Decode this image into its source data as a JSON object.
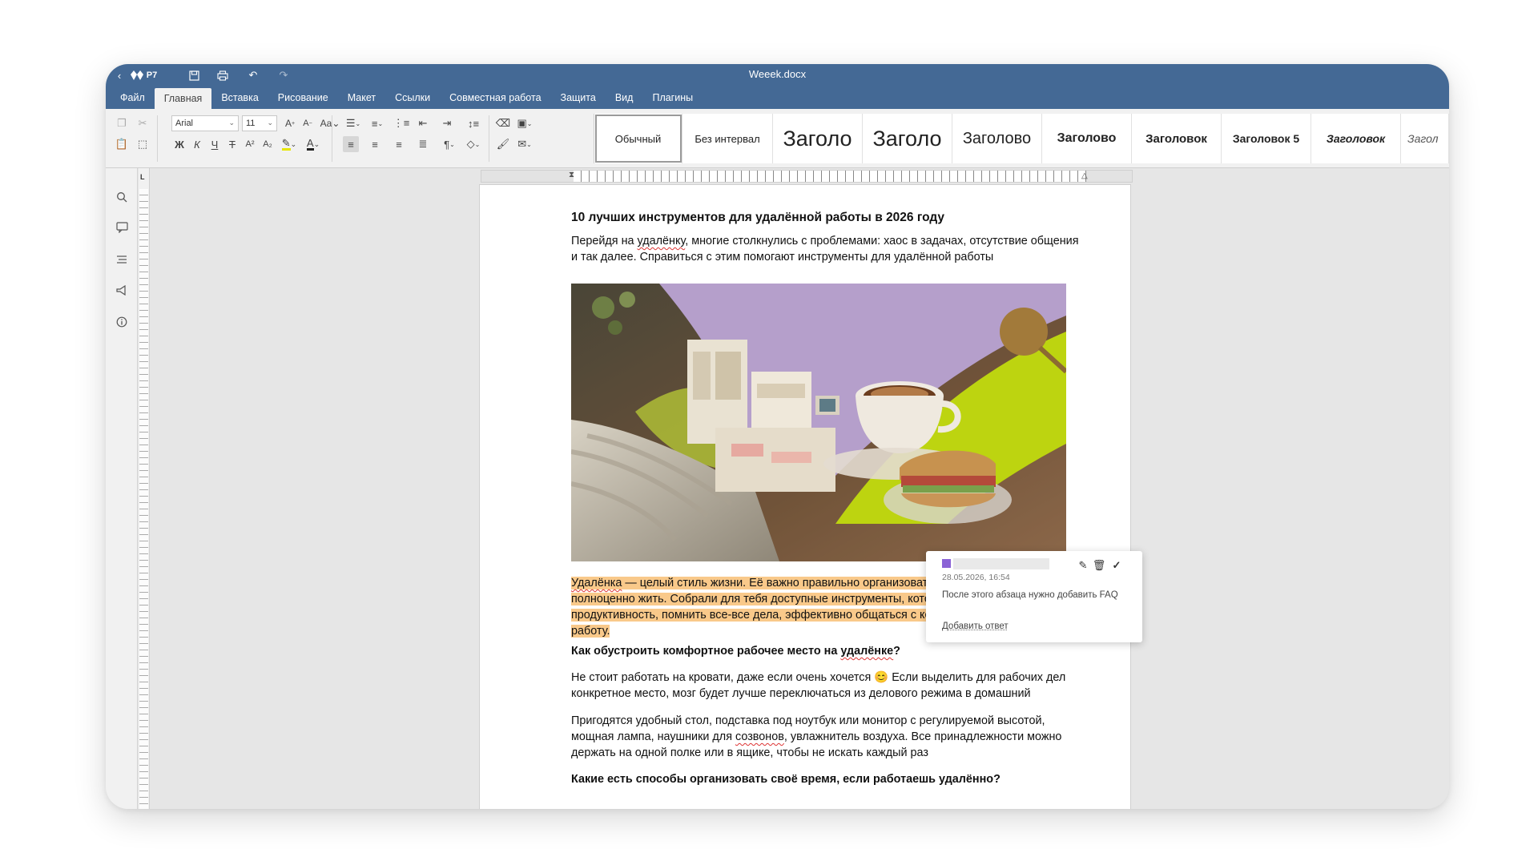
{
  "titlebar": {
    "app_label": "Р7",
    "doc_title": "Weeek.docx",
    "back_icon": "chevron-left-icon",
    "save_icon": "save-icon",
    "print_icon": "print-icon",
    "undo_icon": "undo-icon",
    "redo_icon": "redo-icon"
  },
  "menu": {
    "items": [
      {
        "label": "Файл"
      },
      {
        "label": "Главная",
        "active": true
      },
      {
        "label": "Вставка"
      },
      {
        "label": "Рисование"
      },
      {
        "label": "Макет"
      },
      {
        "label": "Ссылки"
      },
      {
        "label": "Совместная работа"
      },
      {
        "label": "Защита"
      },
      {
        "label": "Вид"
      },
      {
        "label": "Плагины"
      }
    ]
  },
  "toolbar": {
    "font_name": "Arial",
    "font_size": "11",
    "bold": "Ж",
    "italic": "К",
    "underline": "Ч",
    "strike": "Т",
    "superscript": "A²",
    "subscript": "A₂",
    "grow_font": "A",
    "shrink_font": "A",
    "change_case": "Aa",
    "font_color": "A",
    "highlight_color": "#e6e600",
    "font_color_value": "#222222"
  },
  "styles": [
    {
      "label": "Обычный",
      "selected": true
    },
    {
      "label": "Без интервал"
    },
    {
      "label": "Заголо"
    },
    {
      "label": "Заголо"
    },
    {
      "label": "Заголово"
    },
    {
      "label": "Заголово"
    },
    {
      "label": "Заголовок"
    },
    {
      "label": "Заголовок 5"
    },
    {
      "label": "Заголовок"
    },
    {
      "label": "Загол"
    }
  ],
  "sidebar": {
    "icons": [
      "search-icon",
      "comments-icon",
      "navigation-icon",
      "feedback-icon",
      "info-icon"
    ]
  },
  "document": {
    "heading1": "10 лучших инструментов для удалённой работы в 2026 году",
    "intro_pre": "Перейдя на ",
    "intro_spell": "удалёнку",
    "intro_post": ", многие столкнулись с проблемами: хаос в задачах, отсутствие общения и так далее. Справиться с этим помогают инструменты для удалённой работы",
    "highlight_spell": "Удалёнка",
    "highlight_text": " — целый стиль жизни. Её важно правильно организовать, чтобы успевать полноценно жить. Собрали для тебя доступные инструменты, которые помогут сохранять продуктивность, помнить все-все дела, эффективно общаться с коллегами и планировать работу.",
    "heading2_pre": "Как обустроить комфортное рабочее место на ",
    "heading2_spell": "удалёнке",
    "heading2_post": "?",
    "para2": "Не стоит работать на кровати, даже если очень хочется 😊 Если выделить для рабочих дел конкретное место, мозг будет лучше переключаться из делового режима в домашний",
    "para3_pre": "Пригодятся удобный стол, подставка под ноутбук или монитор с регулируемой высотой, мощная лампа, наушники для ",
    "para3_spell": "созвонов",
    "para3_post": ", увлажнитель воздуха. Все принадлежности можно держать на одной полке или в ящике, чтобы не искать каждый раз",
    "heading3": "Какие есть способы организовать своё время, если работаешь удалённо?",
    "highlight_color": "#f9c98a"
  },
  "comment": {
    "date": "28.05.2026, 16:54",
    "text": "После этого абзаца нужно добавить FAQ",
    "reply_label": "Добавить ответ",
    "edit_icon": "pencil-icon",
    "delete_icon": "trash-icon",
    "resolve_icon": "check-icon",
    "avatar_color": "#8b63d6"
  }
}
